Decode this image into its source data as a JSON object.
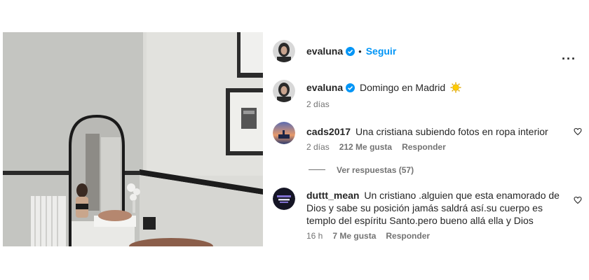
{
  "post": {
    "author": "evaluna",
    "separator": "•",
    "follow_label": "Seguir",
    "more_label": "···",
    "caption": "Domingo en Madrid",
    "caption_emoji": "sun",
    "time": "2 días"
  },
  "view_replies_label": "Ver respuestas (57)",
  "comments": [
    {
      "username": "cads2017",
      "text": "Una cristiana subiendo fotos en ropa interior",
      "time": "2 días",
      "likes": "212 Me gusta",
      "reply_label": "Responder"
    },
    {
      "username": "duttt_mean",
      "text": "Un cristiano .alguien que esta enamorado de Dios y sabe su posición jamás saldrá así.su cuerpo es templo del espíritu Santo.pero bueno allá ella y Dios",
      "time": "16 h",
      "likes": "7 Me gusta",
      "reply_label": "Responder"
    }
  ],
  "icons": [
    "verified-badge-icon",
    "more-options-icon",
    "heart-icon",
    "sun-emoji-icon"
  ],
  "colors": {
    "link_blue": "#0095f6",
    "verified_blue": "#0095f6",
    "muted": "#737373",
    "text": "#262626"
  }
}
